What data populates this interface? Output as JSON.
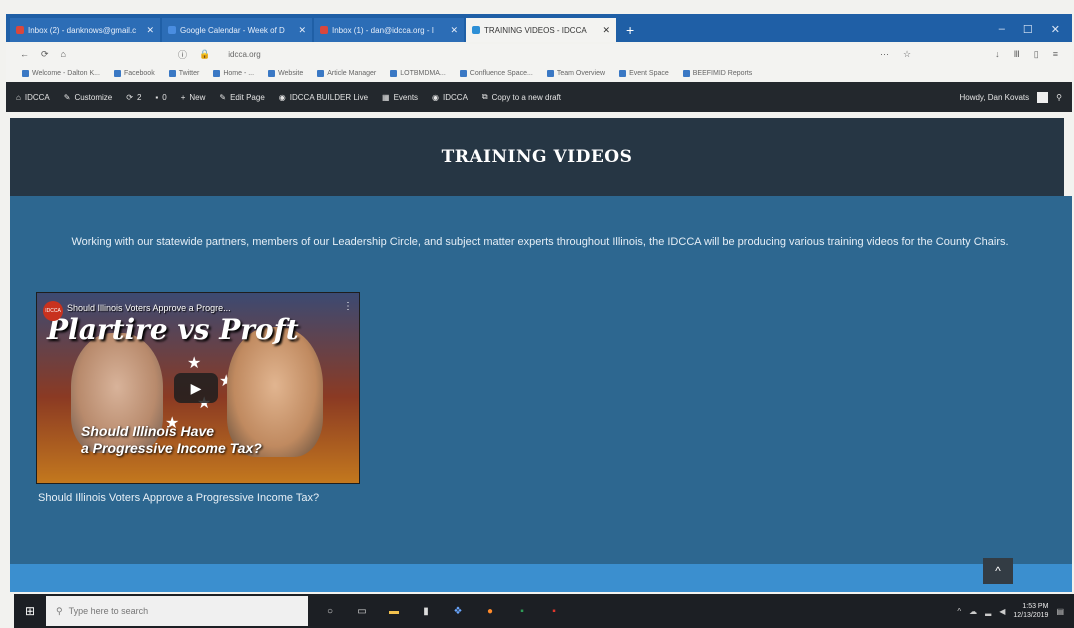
{
  "browser": {
    "tabs": [
      {
        "label": "Inbox (2) - danknows@gmail.c",
        "color": "#d9473d",
        "active": false
      },
      {
        "label": "Google Calendar - Week of D",
        "color": "#4a8de0",
        "active": false
      },
      {
        "label": "Inbox (1) - dan@idcca.org - I",
        "color": "#d9473d",
        "active": false
      },
      {
        "label": "TRAINING VIDEOS - IDCCA",
        "color": "#2d8fd6",
        "active": true
      }
    ],
    "new_tab": "+",
    "window_controls": [
      "–",
      "☐",
      "✕"
    ],
    "url": "idcca.org",
    "bookmarks": [
      "Welcome - Dalton K...",
      "Facebook",
      "Twitter",
      "Home - ...",
      "Website",
      "Article Manager",
      "LOTBMDMA...",
      "Confluence Space...",
      "Team Overview",
      "Event Space",
      "BEEFIMID Reports"
    ]
  },
  "adminbar": {
    "site": "IDCCA",
    "customize": "Customize",
    "updates": "2",
    "comments": "0",
    "new": "New",
    "edit_page": "Edit Page",
    "builder": "IDCCA BUILDER Live",
    "events": "Events",
    "idcca": "IDCCA",
    "copy": "Copy to a new draft",
    "howdy": "Howdy, Dan Kovats"
  },
  "page": {
    "title": "TRAINING VIDEOS",
    "intro": "Working with our statewide partners, members of our Leadership Circle, and subject matter experts throughout Illinois, the IDCCA will be producing various training videos for the County Chairs.",
    "video": {
      "top_title": "Should Illinois Voters Approve a Progre...",
      "big_title": "Plartire vs Proft",
      "logo": "IDCCA",
      "bottom_line1": "Should Illinois Have",
      "bottom_line2": "a Progressive Income Tax?"
    },
    "caption": "Should Illinois Voters Approve a Progressive Income Tax?",
    "scroll_top": "^"
  },
  "taskbar": {
    "search_placeholder": "Type here to search",
    "time": "1:53 PM",
    "date": "12/13/2019"
  }
}
